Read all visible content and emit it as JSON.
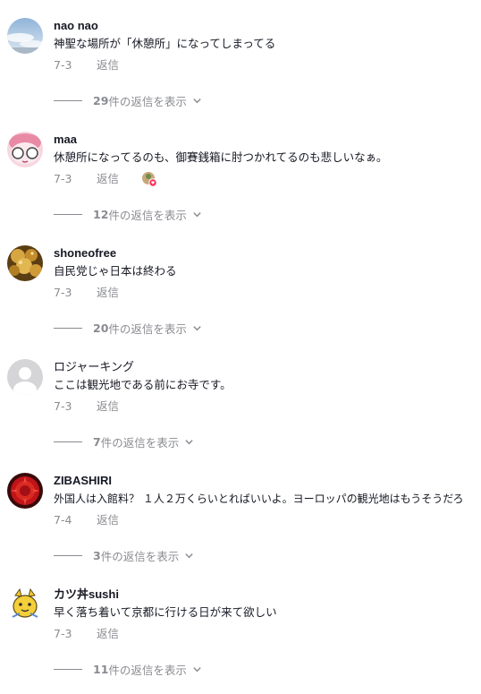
{
  "comments": [
    {
      "username": "nao nao",
      "text": "神聖な場所が「休憩所」になってしまってる",
      "date": "7-3",
      "reply_label": "返信",
      "replies_count": "29",
      "replies_suffix": "件の返信を表示"
    },
    {
      "username": "maa",
      "text": "休憩所になってるのも、御賽銭箱に肘つかれてるのも悲しいなぁ。",
      "date": "7-3",
      "reply_label": "返信",
      "replies_count": "12",
      "replies_suffix": "件の返信を表示"
    },
    {
      "username": "shoneofree",
      "text": "自民党じゃ日本は終わる",
      "date": "7-3",
      "reply_label": "返信",
      "replies_count": "20",
      "replies_suffix": "件の返信を表示"
    },
    {
      "username": "ロジャーキング",
      "text": "ここは観光地である前にお寺です。",
      "date": "7-3",
      "reply_label": "返信",
      "replies_count": "7",
      "replies_suffix": "件の返信を表示"
    },
    {
      "username": "ZIBASHIRI",
      "text": "外国人は入館料？ １人２万くらいとればいいよ。ヨーロッパの観光地はもうそうだろ",
      "date": "7-4",
      "reply_label": "返信",
      "replies_count": "3",
      "replies_suffix": "件の返信を表示"
    },
    {
      "username": "カツ丼sushi",
      "text": "早く落ち着いて京都に行ける日が来て欲しい",
      "date": "7-3",
      "reply_label": "返信",
      "replies_count": "11",
      "replies_suffix": "件の返信を表示"
    }
  ],
  "colors": {
    "text": "#161823",
    "muted": "#8a8b91",
    "like_badge": "#fe2c55"
  }
}
